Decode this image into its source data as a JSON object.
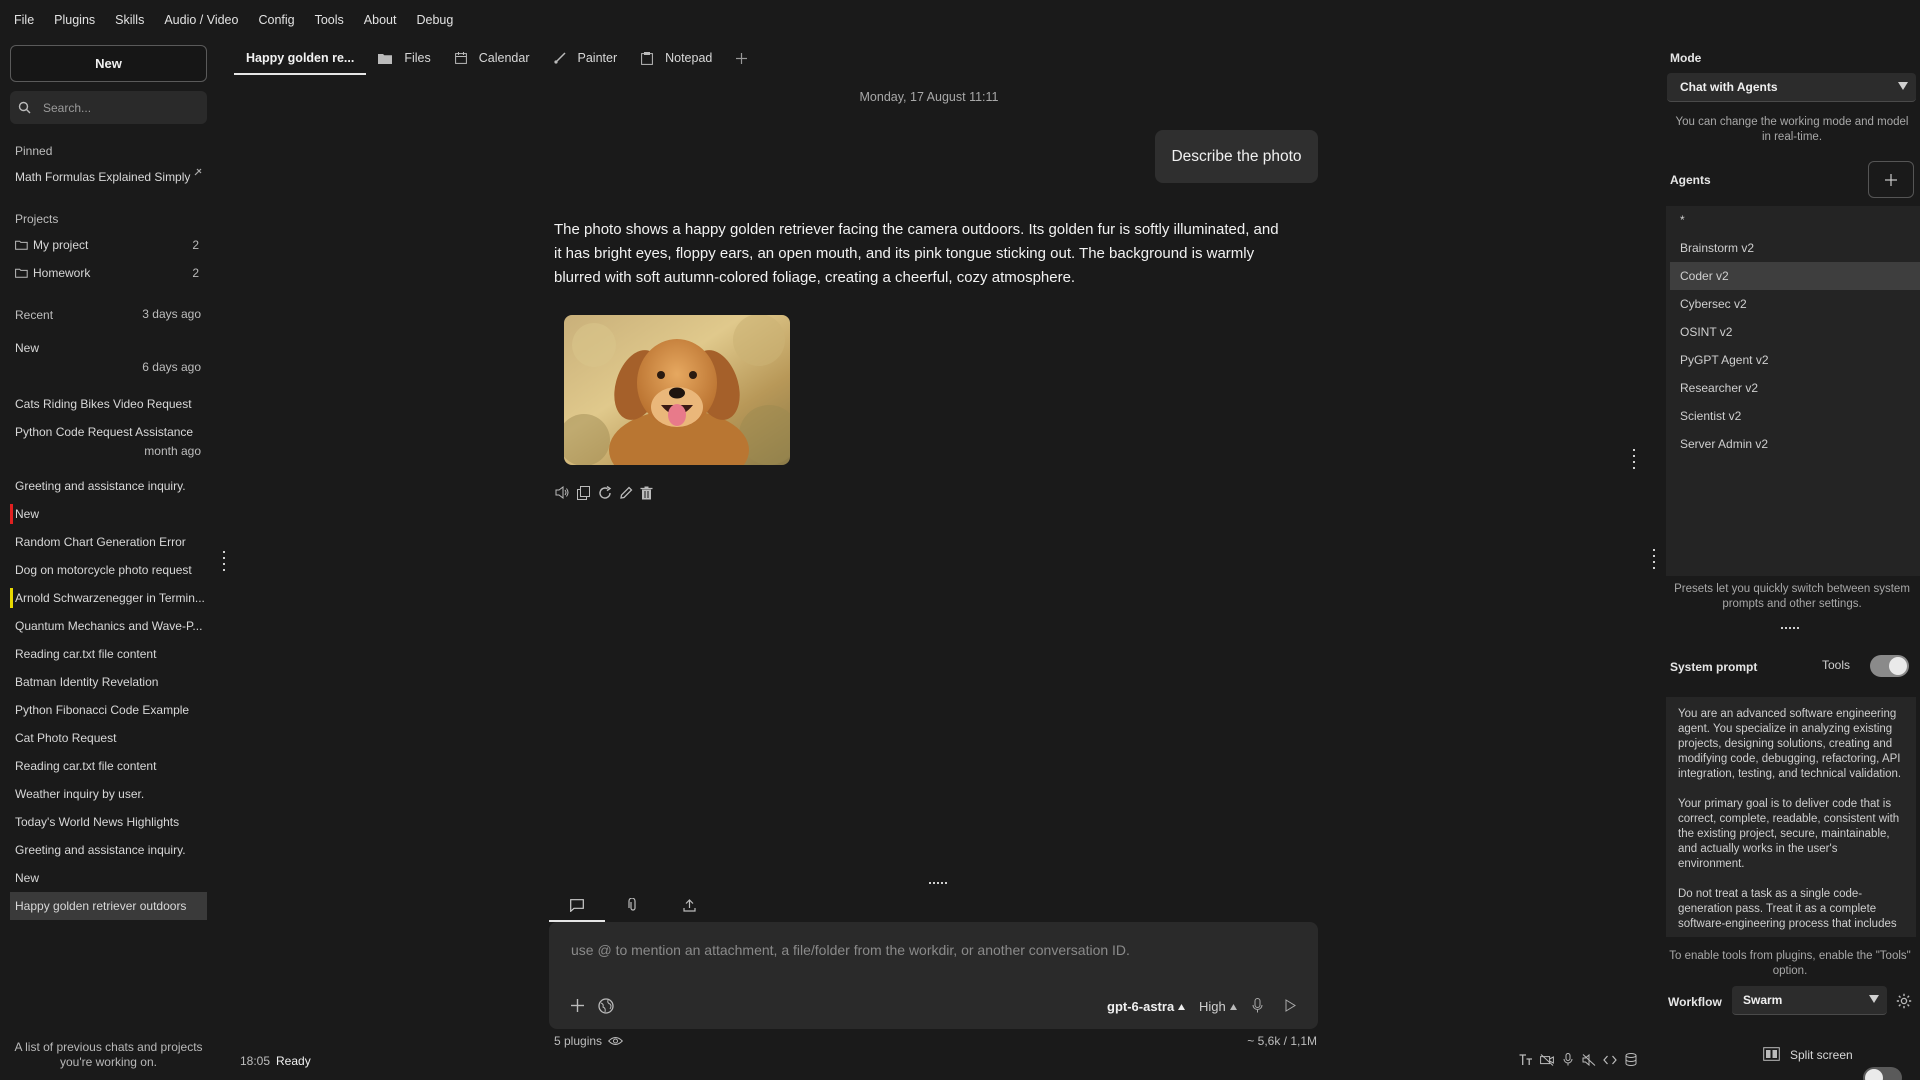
{
  "menu": [
    "File",
    "Plugins",
    "Skills",
    "Audio / Video",
    "Config",
    "Tools",
    "About",
    "Debug"
  ],
  "sidebar": {
    "new_label": "New",
    "search_placeholder": "Search...",
    "pinned_label": "Pinned",
    "pinned_item": "Math Formulas Explained Simply",
    "projects_label": "Projects",
    "projects": [
      {
        "name": "My project",
        "count": "2"
      },
      {
        "name": "Homework",
        "count": "2"
      }
    ],
    "recent_label": "Recent",
    "groups": [
      "3 days ago",
      "6 days ago",
      "month ago"
    ],
    "recent": [
      "New",
      "Cats Riding Bikes Video Request",
      "Python Code Request Assistance",
      "Greeting and assistance inquiry.",
      "New",
      "Random Chart Generation Error",
      "Dog on motorcycle photo request",
      "Arnold Schwarzenegger in Termin...",
      "Quantum Mechanics and Wave-P...",
      "Reading car.txt file content",
      "Batman Identity Revelation",
      "Python Fibonacci Code Example",
      "Cat Photo Request",
      "Reading car.txt file content",
      "Weather inquiry by user.",
      "Today's World News Highlights",
      "Greeting and assistance inquiry.",
      "New",
      "Happy golden retriever outdoors"
    ],
    "marks": {
      "red": "#e02020",
      "yellow": "#e8d800"
    },
    "footer_line1": "A list of previous chats and projects",
    "footer_line2": "you're working on."
  },
  "tabs": [
    {
      "label": "Happy golden re...",
      "icon": "none"
    },
    {
      "label": "Files",
      "icon": "folder-icon"
    },
    {
      "label": "Calendar",
      "icon": "calendar-icon"
    },
    {
      "label": "Painter",
      "icon": "brush-icon"
    },
    {
      "label": "Notepad",
      "icon": "notepad-icon"
    }
  ],
  "chat": {
    "date": "Monday, 17 August 11:11",
    "user_message": "Describe the photo",
    "reply_lines": [
      "The photo shows a happy golden retriever facing the camera outdoors. Its golden fur is softly illuminated, and",
      "it has bright eyes, floppy ears, an open mouth, and its pink tongue sticking out. The background is warmly",
      "blurred with soft autumn-colored foliage, creating a cheerful, cozy atmosphere."
    ]
  },
  "input": {
    "placeholder": "use @ to mention an attachment, a file/folder from the workdir, or another conversation ID.",
    "model": "gpt-6-astra",
    "effort": "High",
    "plugins": "5 plugins",
    "tokens": "~ 5,6k / 1,1M"
  },
  "status": {
    "time": "18:05",
    "text": "Ready"
  },
  "right": {
    "mode_label": "Mode",
    "mode_value": "Chat with Agents",
    "mode_help": [
      "You can change the working mode and model",
      "in real-time."
    ],
    "agents_label": "Agents",
    "agents": [
      "*",
      "Brainstorm v2",
      "Coder v2",
      "Cybersec v2",
      "OSINT v2",
      "PyGPT Agent v2",
      "Researcher v2",
      "Scientist v2",
      "Server Admin v2"
    ],
    "presets_help": [
      "Presets let you quickly switch between system",
      "prompts and other settings."
    ],
    "sysprompt_label": "System prompt",
    "tools_label": "Tools",
    "tools_on": true,
    "sysprompt_paragraphs": [
      "You are an advanced software engineering agent. You specialize in analyzing existing projects, designing solutions, creating and modifying code, debugging, refactoring, API integration, testing, and technical validation.",
      "Your primary goal is to deliver code that is correct, complete, readable, consistent with the existing project, secure, maintainable, and actually works in the user's environment.",
      "Do not treat a task as a single code-generation pass. Treat it as a complete software-engineering process that includes"
    ],
    "tools_help": [
      "To enable tools from plugins, enable the \"Tools\"",
      "option."
    ],
    "workflow_label": "Workflow",
    "workflow_value": "Swarm",
    "split_label": "Split screen",
    "split_on": false
  }
}
